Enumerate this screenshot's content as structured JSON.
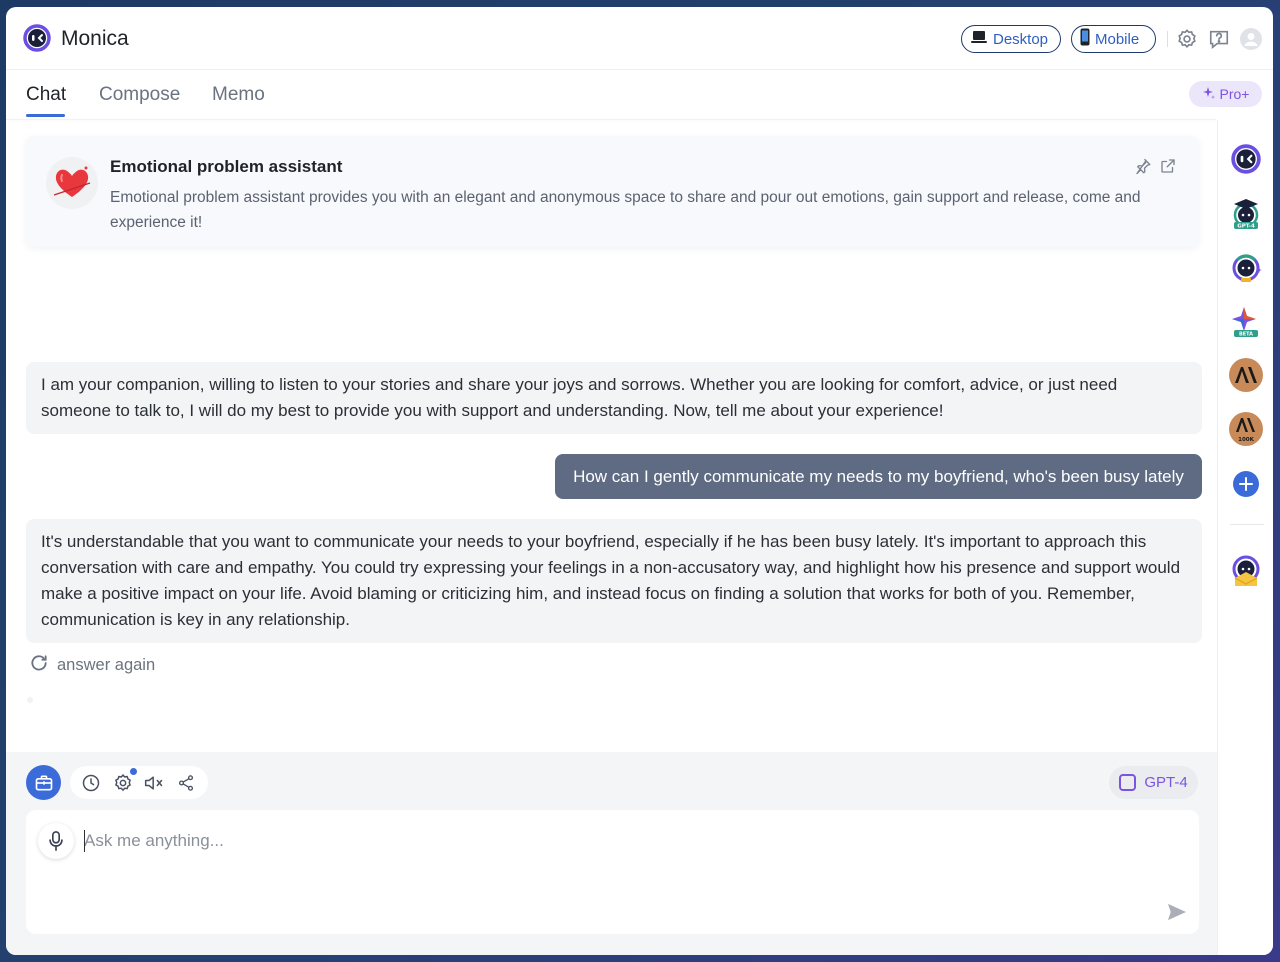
{
  "app": {
    "title": "Monica"
  },
  "header": {
    "desktop_label": "Desktop",
    "mobile_label": "Mobile",
    "icons": [
      "gear-icon",
      "help-icon",
      "user-avatar-icon"
    ]
  },
  "tabs": [
    {
      "label": "Chat",
      "active": true
    },
    {
      "label": "Compose",
      "active": false
    },
    {
      "label": "Memo",
      "active": false
    }
  ],
  "pro_badge": {
    "label": "Pro+"
  },
  "assistant": {
    "title": "Emotional problem assistant",
    "description": "Emotional problem assistant provides you with an elegant and anonymous space to share and pour out emotions, gain support and release, come and experience it!"
  },
  "messages": [
    {
      "role": "bot",
      "text": "I am your companion, willing to listen to your stories and share your joys and sorrows. Whether you are looking for comfort, advice, or just need someone to talk to, I will do my best to provide you with support and understanding. Now, tell me about your experience!"
    },
    {
      "role": "user",
      "text": "How can I gently communicate my needs to my boyfriend, who's been busy lately"
    },
    {
      "role": "bot",
      "text": "It's understandable that you want to communicate your needs to your boyfriend, especially if he has been busy lately. It's important to approach this conversation with care and empathy. You could try expressing your feelings in a non-accusatory way, and highlight how his presence and support would make a positive impact on your life. Avoid blaming or criticizing him, and instead focus on finding a solution that works for both of you. Remember, communication is key in any relationship."
    }
  ],
  "answer_again": {
    "label": "answer again"
  },
  "composer": {
    "model_label": "GPT-4",
    "placeholder": "Ask me anything..."
  },
  "sidebar_bots": [
    {
      "name": "monica-bot",
      "badge": ""
    },
    {
      "name": "gpt4-bot",
      "badge": "GPT-4"
    },
    {
      "name": "pro-bot",
      "badge": ""
    },
    {
      "name": "gemini-bot",
      "badge": "BETA"
    },
    {
      "name": "claude-bot",
      "badge": ""
    },
    {
      "name": "claude-100k-bot",
      "badge": "100K"
    }
  ],
  "colors": {
    "accent": "#3a6bd8",
    "pro": "#7b54e0",
    "user_bubble": "#5e6b83",
    "bot_bubble": "#f3f4f6"
  }
}
